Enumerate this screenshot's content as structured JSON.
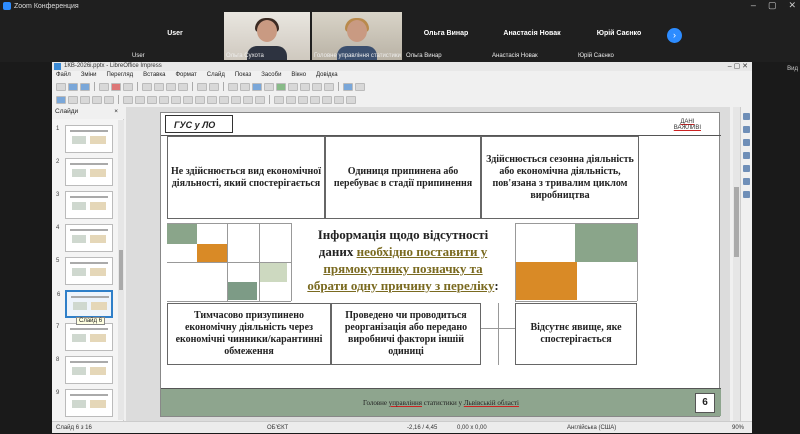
{
  "zoom": {
    "title": "Zoom Конференция",
    "tiles": [
      {
        "name": "User",
        "sub": "User"
      },
      {
        "name": "",
        "sub": "Ольга Сухота"
      },
      {
        "name": "",
        "sub": "Головне управління статистики"
      },
      {
        "name": "Ольга Винар",
        "sub": "Ольга Винар"
      },
      {
        "name": "Анастасія Новак",
        "sub": "Анастасія Новак"
      },
      {
        "name": "Юрій Саєнко",
        "sub": "Юрій Саєнко"
      }
    ],
    "next_symbol": "›",
    "view_label": "Вид"
  },
  "app": {
    "title": "1КВ-2026i.pptx - LibreOffice Impress",
    "menu": [
      "Файл",
      "Зміни",
      "Перегляд",
      "Вставка",
      "Формат",
      "Слайд",
      "Показ",
      "Засоби",
      "Вікно",
      "Довідка"
    ],
    "panel_title": "Слайди",
    "panel_close": "×",
    "tooltip": "Слайд 6",
    "slide_numbers": [
      "1",
      "2",
      "3",
      "4",
      "5",
      "6",
      "7",
      "8",
      "9"
    ]
  },
  "slide": {
    "header_tag": "ГУС у ЛО",
    "dani_line1": "ДАНІ",
    "dani_line2": "ВАЖЛИВІ",
    "box1": "Не здійснюється вид економічної діяльності, який спостерігається",
    "box2": "Одиниця припинена або перебуває в стадії припинення",
    "box3": "Здійснюється сезонна діяльність або економічна діяльність, пов'язана з тривалим циклом виробництва",
    "center_l1": "Інформація щодо відсутності",
    "center_l2a": "даних ",
    "center_l2b": "необхідно поставити у",
    "center_l3": "прямокутнику позначку та",
    "center_l4": "обрати одну причину з переліку",
    "center_l4b": ":",
    "box4": "Тимчасово призупинено економічну діяльність через економічні чинники/карантинні обмеження",
    "box5": "Проведено чи проводиться реорганізація або передано виробничі фактори іншій одиниці",
    "box6": "Відсутнє явище, яке спостерігається",
    "footer_a": "Головне ",
    "footer_b": "управління",
    "footer_c": " статистики у ",
    "footer_d": "Львівській області",
    "page_number": "6",
    "colors": {
      "green": "#8aa58a",
      "orange": "#d98a26",
      "light_green": "#cdd9c0",
      "pale_green": "#dfe8d6",
      "dark_green": "#7d9b86"
    }
  },
  "status": {
    "slide": "Слайд 6 з 16",
    "object": "ОБ'ЄКТ",
    "pos": "-2,16 / 4,45",
    "size": "0,00 x 0,00",
    "lang": "Англійська (США)",
    "zoom": "90%"
  }
}
